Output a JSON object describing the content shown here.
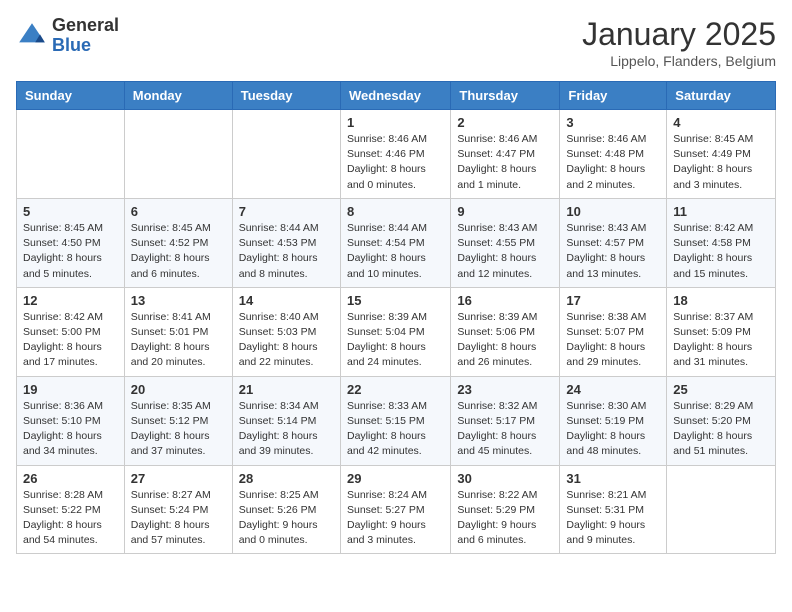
{
  "header": {
    "logo_general": "General",
    "logo_blue": "Blue",
    "month_title": "January 2025",
    "location": "Lippelo, Flanders, Belgium"
  },
  "weekdays": [
    "Sunday",
    "Monday",
    "Tuesday",
    "Wednesday",
    "Thursday",
    "Friday",
    "Saturday"
  ],
  "weeks": [
    [
      {
        "day": "",
        "info": ""
      },
      {
        "day": "",
        "info": ""
      },
      {
        "day": "",
        "info": ""
      },
      {
        "day": "1",
        "info": "Sunrise: 8:46 AM\nSunset: 4:46 PM\nDaylight: 8 hours\nand 0 minutes."
      },
      {
        "day": "2",
        "info": "Sunrise: 8:46 AM\nSunset: 4:47 PM\nDaylight: 8 hours\nand 1 minute."
      },
      {
        "day": "3",
        "info": "Sunrise: 8:46 AM\nSunset: 4:48 PM\nDaylight: 8 hours\nand 2 minutes."
      },
      {
        "day": "4",
        "info": "Sunrise: 8:45 AM\nSunset: 4:49 PM\nDaylight: 8 hours\nand 3 minutes."
      }
    ],
    [
      {
        "day": "5",
        "info": "Sunrise: 8:45 AM\nSunset: 4:50 PM\nDaylight: 8 hours\nand 5 minutes."
      },
      {
        "day": "6",
        "info": "Sunrise: 8:45 AM\nSunset: 4:52 PM\nDaylight: 8 hours\nand 6 minutes."
      },
      {
        "day": "7",
        "info": "Sunrise: 8:44 AM\nSunset: 4:53 PM\nDaylight: 8 hours\nand 8 minutes."
      },
      {
        "day": "8",
        "info": "Sunrise: 8:44 AM\nSunset: 4:54 PM\nDaylight: 8 hours\nand 10 minutes."
      },
      {
        "day": "9",
        "info": "Sunrise: 8:43 AM\nSunset: 4:55 PM\nDaylight: 8 hours\nand 12 minutes."
      },
      {
        "day": "10",
        "info": "Sunrise: 8:43 AM\nSunset: 4:57 PM\nDaylight: 8 hours\nand 13 minutes."
      },
      {
        "day": "11",
        "info": "Sunrise: 8:42 AM\nSunset: 4:58 PM\nDaylight: 8 hours\nand 15 minutes."
      }
    ],
    [
      {
        "day": "12",
        "info": "Sunrise: 8:42 AM\nSunset: 5:00 PM\nDaylight: 8 hours\nand 17 minutes."
      },
      {
        "day": "13",
        "info": "Sunrise: 8:41 AM\nSunset: 5:01 PM\nDaylight: 8 hours\nand 20 minutes."
      },
      {
        "day": "14",
        "info": "Sunrise: 8:40 AM\nSunset: 5:03 PM\nDaylight: 8 hours\nand 22 minutes."
      },
      {
        "day": "15",
        "info": "Sunrise: 8:39 AM\nSunset: 5:04 PM\nDaylight: 8 hours\nand 24 minutes."
      },
      {
        "day": "16",
        "info": "Sunrise: 8:39 AM\nSunset: 5:06 PM\nDaylight: 8 hours\nand 26 minutes."
      },
      {
        "day": "17",
        "info": "Sunrise: 8:38 AM\nSunset: 5:07 PM\nDaylight: 8 hours\nand 29 minutes."
      },
      {
        "day": "18",
        "info": "Sunrise: 8:37 AM\nSunset: 5:09 PM\nDaylight: 8 hours\nand 31 minutes."
      }
    ],
    [
      {
        "day": "19",
        "info": "Sunrise: 8:36 AM\nSunset: 5:10 PM\nDaylight: 8 hours\nand 34 minutes."
      },
      {
        "day": "20",
        "info": "Sunrise: 8:35 AM\nSunset: 5:12 PM\nDaylight: 8 hours\nand 37 minutes."
      },
      {
        "day": "21",
        "info": "Sunrise: 8:34 AM\nSunset: 5:14 PM\nDaylight: 8 hours\nand 39 minutes."
      },
      {
        "day": "22",
        "info": "Sunrise: 8:33 AM\nSunset: 5:15 PM\nDaylight: 8 hours\nand 42 minutes."
      },
      {
        "day": "23",
        "info": "Sunrise: 8:32 AM\nSunset: 5:17 PM\nDaylight: 8 hours\nand 45 minutes."
      },
      {
        "day": "24",
        "info": "Sunrise: 8:30 AM\nSunset: 5:19 PM\nDaylight: 8 hours\nand 48 minutes."
      },
      {
        "day": "25",
        "info": "Sunrise: 8:29 AM\nSunset: 5:20 PM\nDaylight: 8 hours\nand 51 minutes."
      }
    ],
    [
      {
        "day": "26",
        "info": "Sunrise: 8:28 AM\nSunset: 5:22 PM\nDaylight: 8 hours\nand 54 minutes."
      },
      {
        "day": "27",
        "info": "Sunrise: 8:27 AM\nSunset: 5:24 PM\nDaylight: 8 hours\nand 57 minutes."
      },
      {
        "day": "28",
        "info": "Sunrise: 8:25 AM\nSunset: 5:26 PM\nDaylight: 9 hours\nand 0 minutes."
      },
      {
        "day": "29",
        "info": "Sunrise: 8:24 AM\nSunset: 5:27 PM\nDaylight: 9 hours\nand 3 minutes."
      },
      {
        "day": "30",
        "info": "Sunrise: 8:22 AM\nSunset: 5:29 PM\nDaylight: 9 hours\nand 6 minutes."
      },
      {
        "day": "31",
        "info": "Sunrise: 8:21 AM\nSunset: 5:31 PM\nDaylight: 9 hours\nand 9 minutes."
      },
      {
        "day": "",
        "info": ""
      }
    ]
  ]
}
